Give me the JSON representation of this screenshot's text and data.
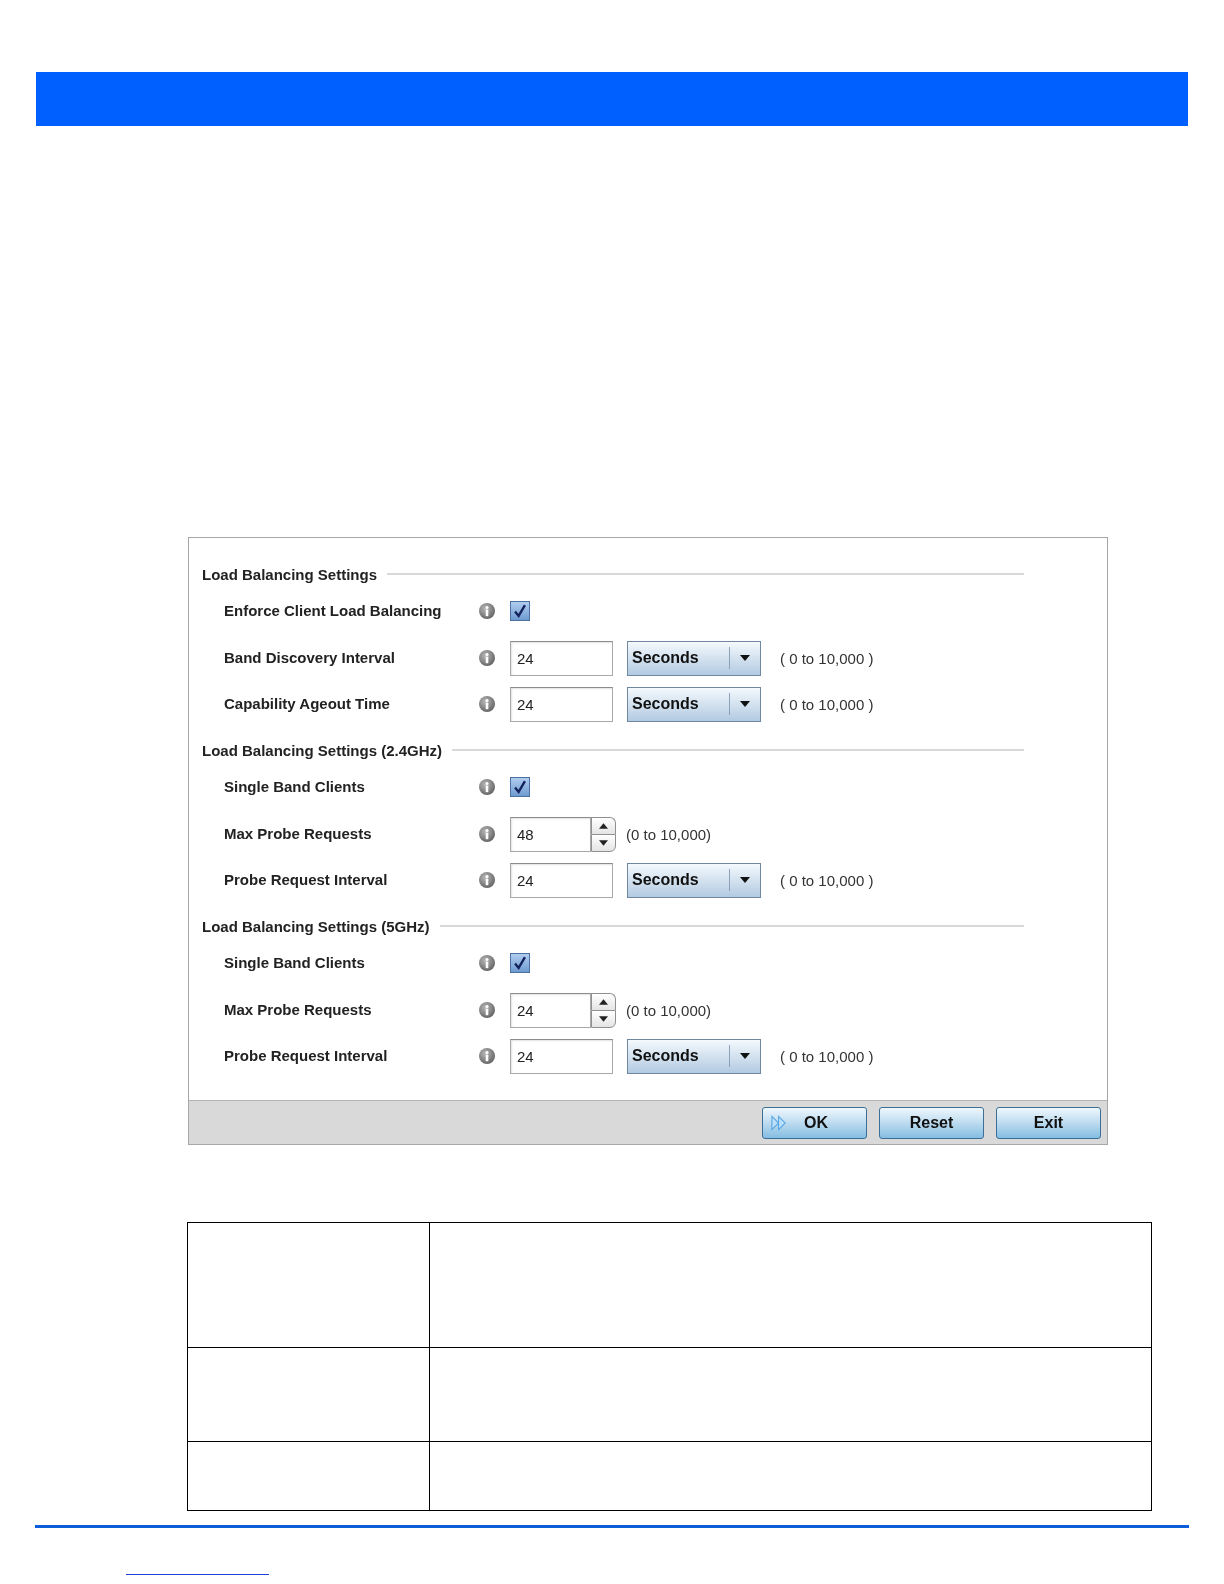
{
  "dialog": {
    "sections": [
      {
        "title": "Load Balancing Settings",
        "rows": [
          {
            "kind": "checkbox",
            "label": "Enforce Client Load Balancing",
            "checked": true
          },
          {
            "kind": "select",
            "label": "Band Discovery Interval",
            "value": "24",
            "unit": "Seconds",
            "range": "( 0 to 10,000 )"
          },
          {
            "kind": "select",
            "label": "Capability Ageout Time",
            "value": "24",
            "unit": "Seconds",
            "range": "( 0 to 10,000 )"
          }
        ]
      },
      {
        "title": "Load Balancing Settings (2.4GHz)",
        "rows": [
          {
            "kind": "checkbox",
            "label": "Single Band Clients",
            "checked": true
          },
          {
            "kind": "spinner",
            "label": "Max Probe Requests",
            "value": "48",
            "range": "(0 to 10,000)"
          },
          {
            "kind": "select",
            "label": "Probe Request Interval",
            "value": "24",
            "unit": "Seconds",
            "range": "( 0 to 10,000 )"
          }
        ]
      },
      {
        "title": "Load Balancing Settings (5GHz)",
        "rows": [
          {
            "kind": "checkbox",
            "label": "Single Band Clients",
            "checked": true
          },
          {
            "kind": "spinner",
            "label": "Max Probe Requests",
            "value": "24",
            "range": "(0 to 10,000)"
          },
          {
            "kind": "select",
            "label": "Probe Request Interval",
            "value": "24",
            "unit": "Seconds",
            "range": "( 0 to 10,000 )"
          }
        ]
      }
    ],
    "buttons": [
      {
        "kind": "confirm",
        "label": "OK"
      },
      {
        "kind": "reset",
        "label": "Reset"
      },
      {
        "kind": "exit",
        "label": "Exit"
      }
    ]
  }
}
